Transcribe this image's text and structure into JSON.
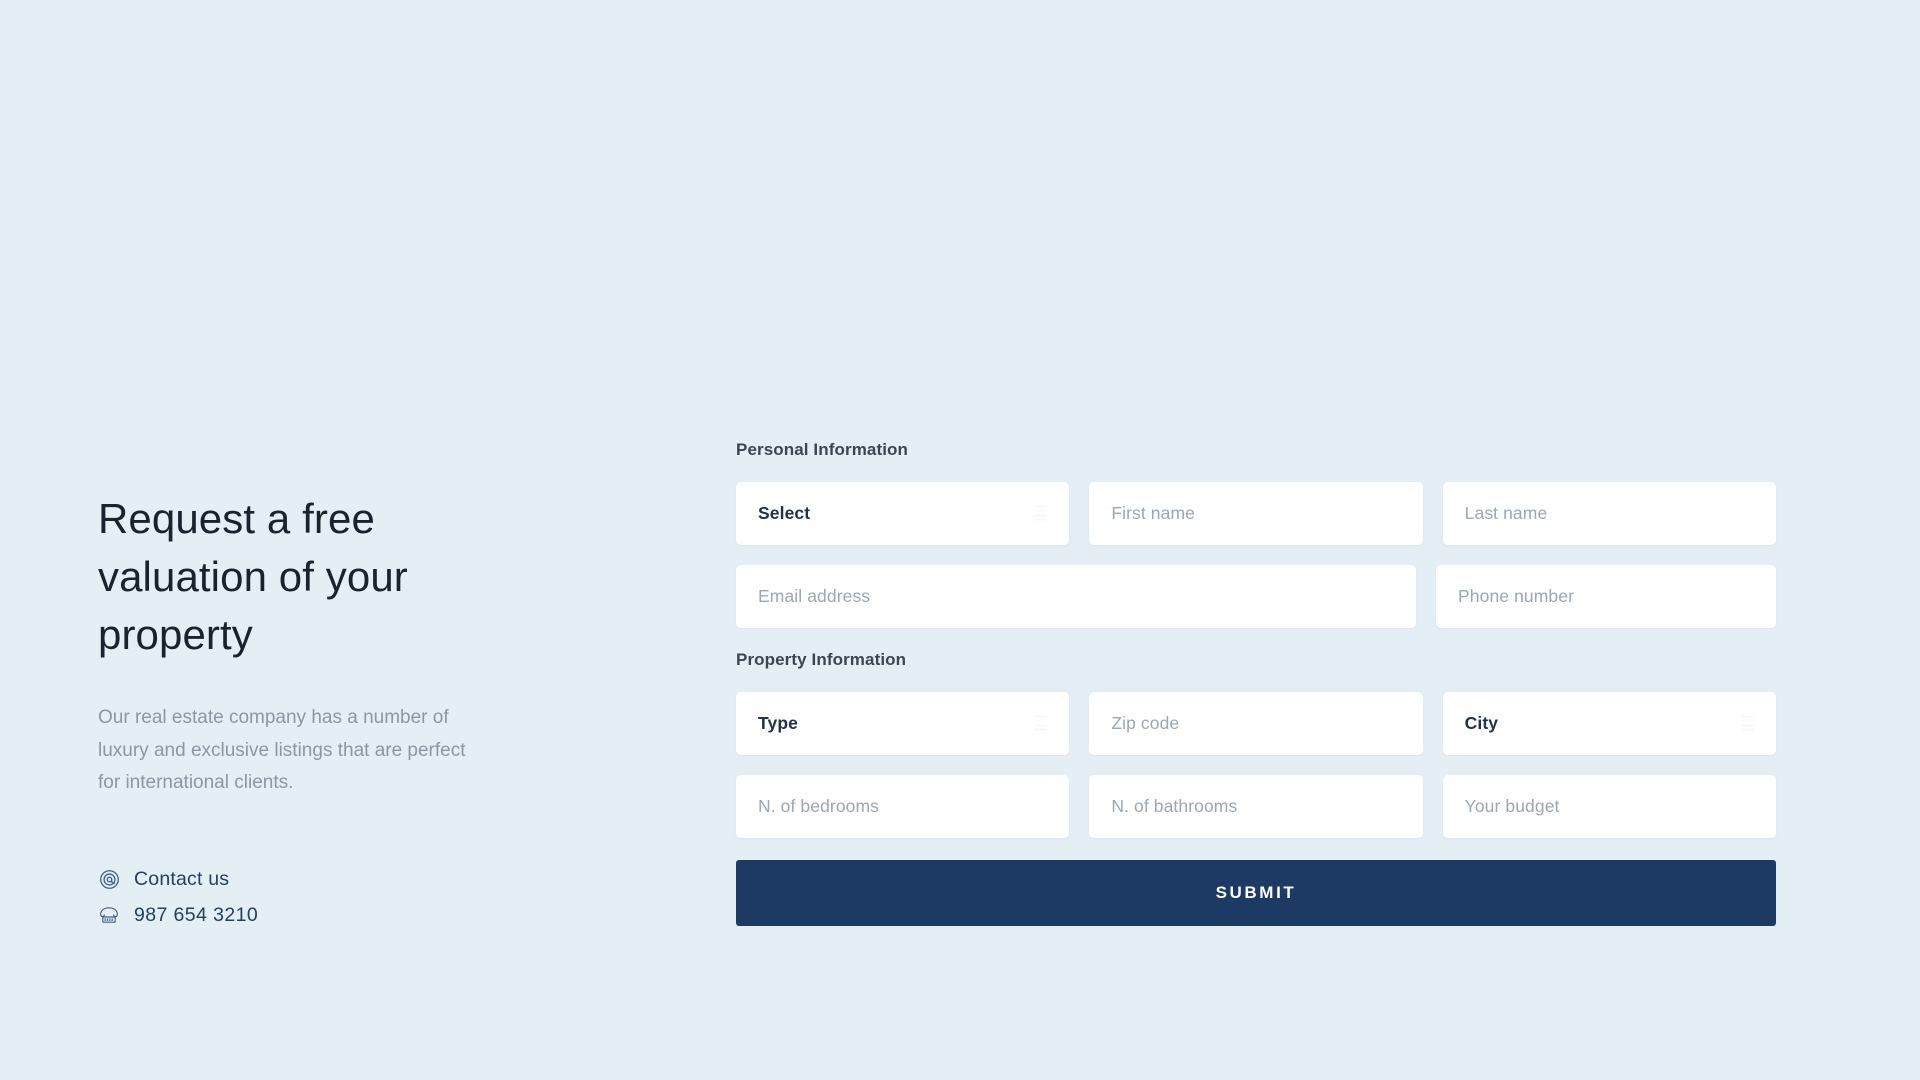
{
  "theme": {
    "background": "#e3eef5",
    "accent_navy": "#1c3a63",
    "heading_color": "#1a2230",
    "placeholder_color": "#9aa7b4",
    "body_text_color": "#8c97a3"
  },
  "intro": {
    "headline": "Request a free valuation of your property",
    "paragraph": "Our real estate company has a number of luxury and exclusive listings that are perfect for international clients.",
    "contact": [
      {
        "icon": "at-sign-circle-icon",
        "text": "Contact us"
      },
      {
        "icon": "telephone-icon",
        "text": "987 654 3210"
      }
    ]
  },
  "form": {
    "sections": [
      {
        "label": "Personal Information",
        "rows": [
          {
            "fields": [
              {
                "name": "title-select",
                "type": "select",
                "value": "Select",
                "span": 1
              },
              {
                "name": "first-name-input",
                "type": "text",
                "value": "First name",
                "span": 1
              },
              {
                "name": "last-name-input",
                "type": "text",
                "value": "Last name",
                "span": 1
              }
            ]
          },
          {
            "fields": [
              {
                "name": "email-input",
                "type": "text",
                "value": "Email address",
                "span": 2
              },
              {
                "name": "phone-input",
                "type": "text",
                "value": "Phone number",
                "span": 1
              }
            ]
          }
        ]
      },
      {
        "label": "Property Information",
        "rows": [
          {
            "fields": [
              {
                "name": "property-type-select",
                "type": "select",
                "value": "Type",
                "span": 1
              },
              {
                "name": "zip-code-input",
                "type": "text",
                "value": "Zip code",
                "span": 1
              },
              {
                "name": "city-select",
                "type": "select",
                "value": "City",
                "span": 1
              }
            ]
          },
          {
            "fields": [
              {
                "name": "bedrooms-input",
                "type": "text",
                "value": "N. of bedrooms",
                "span": 1
              },
              {
                "name": "bathrooms-input",
                "type": "text",
                "value": "N. of bathrooms",
                "span": 1
              },
              {
                "name": "budget-input",
                "type": "text",
                "value": "Your budget",
                "span": 1
              }
            ]
          }
        ]
      }
    ],
    "submit_label": "SUBMIT"
  }
}
